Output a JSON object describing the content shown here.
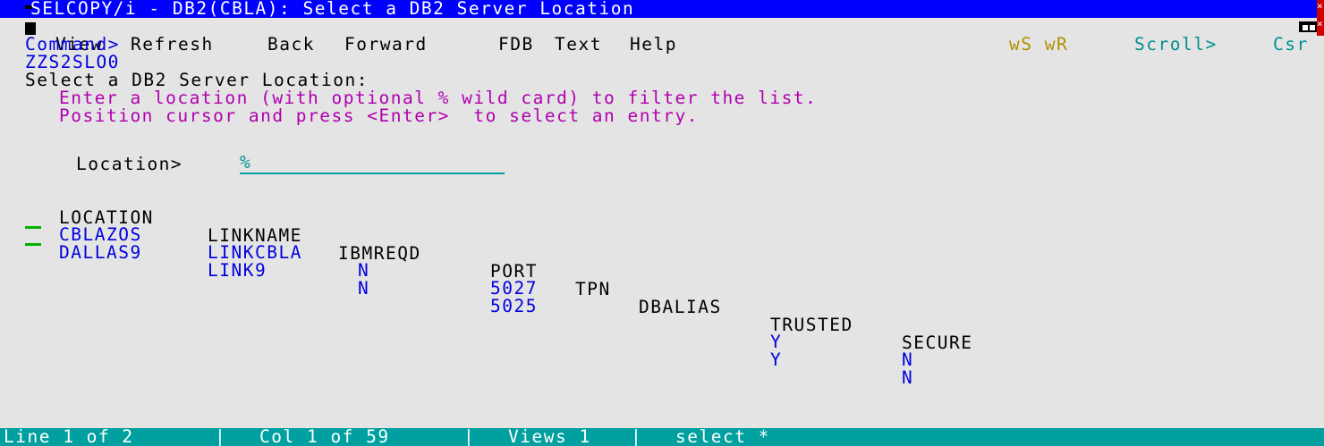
{
  "title": "SELCOPY/i - DB2(CBLA): Select a DB2 Server Location",
  "menu": [
    "View",
    "Refresh",
    "Back",
    "Forward",
    "FDB",
    "Text",
    "Help"
  ],
  "ws_indicator": "wS wR",
  "command_label": "Command>",
  "scroll_label": "Scroll>",
  "scroll_value": "Csr",
  "panel_id": "ZZS2SLO0",
  "heading": "Select a DB2 Server Location:",
  "instructions": [
    "Enter a location (with optional % wild card) to filter the list.",
    "Position cursor and press <Enter>  to select an entry."
  ],
  "location_label": "Location>",
  "location_value": "%",
  "table": {
    "columns": [
      "LOCATION",
      "LINKNAME",
      "IBMREQD",
      "PORT",
      "TPN",
      "DBALIAS",
      "TRUSTED",
      "SECURE"
    ],
    "rows": [
      {
        "location": "CBLAZOS",
        "linkname": "LINKCBLA",
        "ibmreqd": "N",
        "port": "5027",
        "tpn": "",
        "dbalias": "",
        "trusted": "Y",
        "secure": "N"
      },
      {
        "location": "DALLAS9",
        "linkname": "LINK9",
        "ibmreqd": "N",
        "port": "5025",
        "tpn": "",
        "dbalias": "",
        "trusted": "Y",
        "secure": "N"
      }
    ]
  },
  "status": {
    "line": "Line 1 of 2",
    "col": "Col 1 of 59",
    "views": "Views 1",
    "command": "select *",
    "separator": "|"
  },
  "colors": {
    "title_bg": "#0000ff",
    "status_bg": "#00a0a0",
    "screen_bg": "#e4e4e4",
    "field_blue": "#0000e0",
    "instruction_magenta": "#b000b0",
    "accent_teal": "#009090",
    "close_red": "#d00000"
  }
}
